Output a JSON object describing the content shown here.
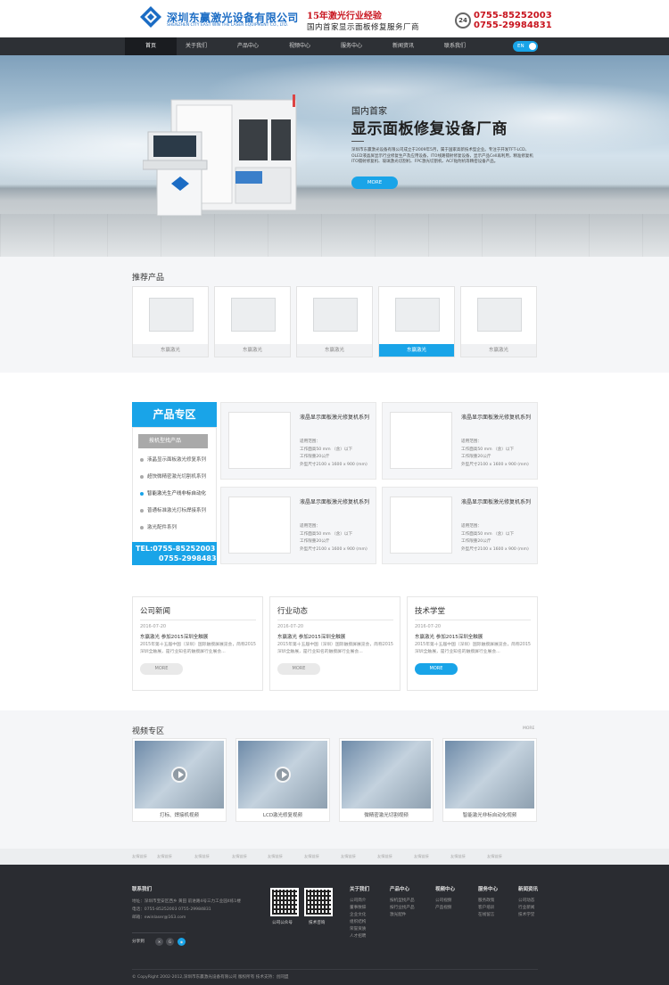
{
  "header": {
    "logo_cn": "深圳东赢激光设备有限公司",
    "logo_en": "SHENZHEN CITY EAST WIN THE LASER EQUIPMENT CO., LTD.",
    "slogan_1": "15年激光行业经验",
    "slogan_2": "国内首家显示面板修复服务厂商",
    "phone_badge": "24",
    "phones": [
      "0755-85252003",
      "0755-29984831"
    ]
  },
  "nav": {
    "items": [
      "首页",
      "关于我们",
      "产品中心",
      "视频中心",
      "服务中心",
      "新闻资讯",
      "联系我们"
    ],
    "lang": "EN"
  },
  "banner": {
    "subtitle": "国内首家",
    "title": "显示面板修复设备厂商",
    "description": "深圳市东赢激光设备有限公司成立于2009年5月，属于国家高新技术型企业。专注于开发TFT-LCD、OLED液晶屏显示行业修复生产及应用设备，ITO线路镭射修复设备，显示产品Cell再利用，精准修复机ITO镭射修复机、玻璃激光切割机、FPC激光切割机、ACF贴附机等精密设备产品。",
    "button": "MORE"
  },
  "recommended": {
    "title": "推荐产品",
    "items": [
      {
        "label": "东赢激光"
      },
      {
        "label": "东赢激光"
      },
      {
        "label": "东赢激光"
      },
      {
        "label": "东赢激光"
      },
      {
        "label": "东赢激光"
      }
    ]
  },
  "product_zone": {
    "title": "产品专区",
    "category": "按机型找产品",
    "items": [
      "液晶显示面板激光修复系列",
      "超快微精密激光切割机系列",
      "智能激光生产线非标自动化",
      "普通标准激光打标焊接系列",
      "激光配件系列"
    ],
    "tel_1": "TEL:0755-85252003",
    "tel_2": "0755-29984831",
    "cards": [
      {
        "name": "液晶显示面板激光修复机系列",
        "spec_1": "适用范围：",
        "spec_2": "工作面高50 mm （含）以下",
        "spec_3": "工作限重20公斤",
        "spec_4": "外型尺寸2100 x 1600 x 900 (mm)"
      },
      {
        "name": "液晶显示面板激光修复机系列",
        "spec_1": "适用范围：",
        "spec_2": "工作面高50 mm （含）以下",
        "spec_3": "工作限重20公斤",
        "spec_4": "外型尺寸2100 x 1600 x 900 (mm)"
      },
      {
        "name": "液晶显示面板激光修复机系列",
        "spec_1": "适用范围：",
        "spec_2": "工作面高50 mm （含）以下",
        "spec_3": "工作限重20公斤",
        "spec_4": "外型尺寸2100 x 1600 x 900 (mm)"
      },
      {
        "name": "液晶显示面板激光修复机系列",
        "spec_1": "适用范围：",
        "spec_2": "工作面高50 mm （含）以下",
        "spec_3": "工作限重20公斤",
        "spec_4": "外型尺寸2100 x 1600 x 900 (mm)"
      }
    ]
  },
  "news": [
    {
      "title": "公司新闻",
      "date": "2016-07-20",
      "headline": "东赢激光 参加2015深圳全触展",
      "desc": "2015年第十五届中国（深圳）国际触摸屏展览会，简称2015深圳全触展，是行业知名的触摸屏行业展会...",
      "button": "MORE"
    },
    {
      "title": "行业动态",
      "date": "2016-07-20",
      "headline": "东赢激光 参加2015深圳全触展",
      "desc": "2015年第十五届中国（深圳）国际触摸屏展览会，简称2015深圳全触展，是行业知名的触摸屏行业展会...",
      "button": "MORE"
    },
    {
      "title": "技术学堂",
      "date": "2016-07-20",
      "headline": "东赢激光 参加2015深圳全触展",
      "desc": "2015年第十五届中国（深圳）国际触摸屏展览会，简称2015深圳全触展，是行业知名的触摸屏行业展会...",
      "button": "MORE"
    }
  ],
  "videos": {
    "title": "视频专区",
    "more": "MORE",
    "items": [
      {
        "label": "打标、焊接机视频"
      },
      {
        "label": "LCD激光修复视频"
      },
      {
        "label": "微精密激光切割视频"
      },
      {
        "label": "智能激光非标自动化视频"
      }
    ]
  },
  "links": {
    "items": [
      "友情链接",
      "友情链接",
      "友情链接",
      "友情链接",
      "友情链接",
      "友情链接",
      "友情链接",
      "友情链接",
      "友情链接",
      "友情链接",
      "友情链接"
    ]
  },
  "footer": {
    "contact_title": "联系我们",
    "address": "地址：深圳市宝安区西乡 黄田 前进路4号三力工业园4栋1楼",
    "phone": "电话：0755-85252003    0755-29984831",
    "email": "邮箱：ewinlaser@163.com",
    "share": "分享到",
    "qr_1": "公司公众号",
    "qr_2": "技术咨询",
    "cols": [
      {
        "title": "关于我们",
        "items": [
          "公司简介",
          "董事致辞",
          "企业文化",
          "组织结构",
          "荣誉资质",
          "人才招聘"
        ]
      },
      {
        "title": "产品中心",
        "items": [
          "按机型找产品",
          "按行业找产品",
          "激光配件"
        ]
      },
      {
        "title": "视频中心",
        "items": [
          "公司视频",
          "产品视频"
        ]
      },
      {
        "title": "服务中心",
        "items": [
          "服务政策",
          "客户培训",
          "在线留言"
        ]
      },
      {
        "title": "新闻资讯",
        "items": [
          "公司动态",
          "行业新闻",
          "技术学堂"
        ]
      }
    ],
    "copyright": "© CopyRight 2002-2012,深圳市东赢激光设备有限公司 版权所有    技术支持：创同盟"
  }
}
